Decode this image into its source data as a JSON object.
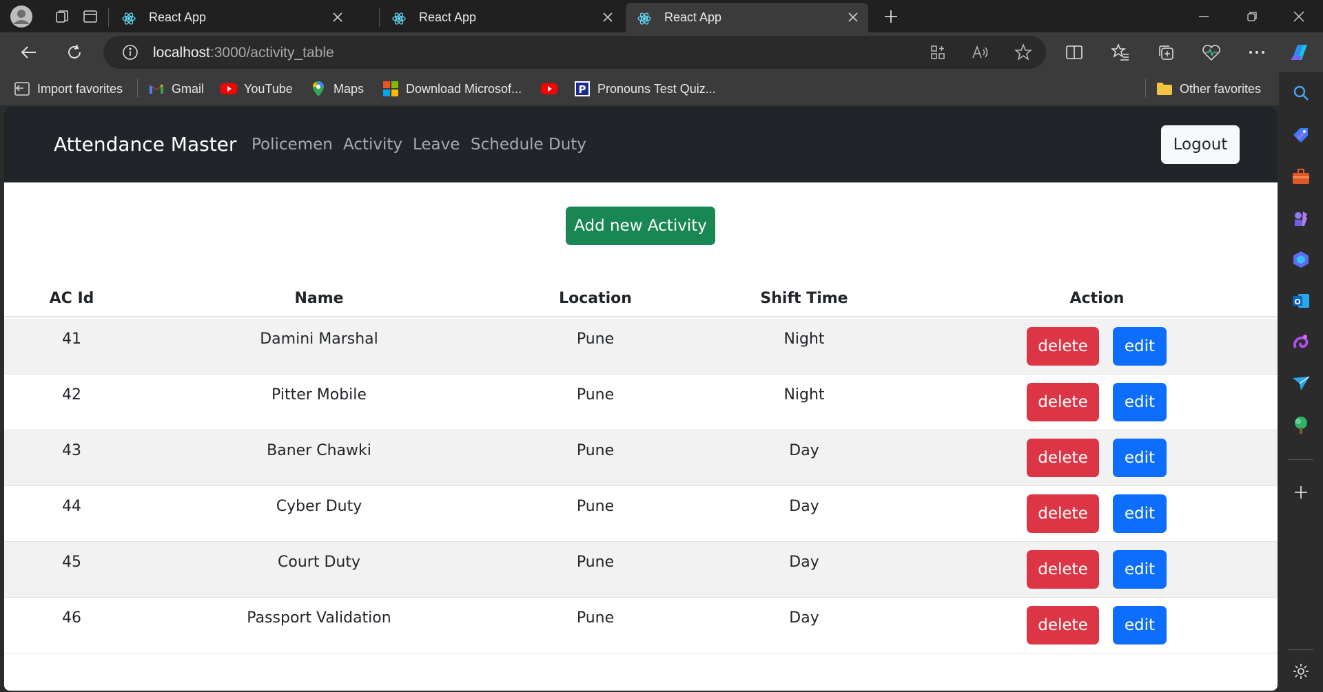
{
  "browser": {
    "tabs": [
      {
        "title": "React App",
        "active": false
      },
      {
        "title": "React App",
        "active": false
      },
      {
        "title": "React App",
        "active": true
      }
    ],
    "url": {
      "host": "localhost",
      "path": ":3000/activity_table"
    },
    "bookmarks": [
      {
        "label": "Import favorites",
        "icon": "import-icon"
      },
      {
        "label": "Gmail",
        "icon": "gmail-icon"
      },
      {
        "label": "YouTube",
        "icon": "youtube-icon"
      },
      {
        "label": "Maps",
        "icon": "maps-pin-icon"
      },
      {
        "label": "Download Microsof...",
        "icon": "microsoft-logo-icon"
      },
      {
        "label": "",
        "icon": "youtube-icon"
      },
      {
        "label": "Pronouns Test Quiz...",
        "icon": "p-logo-icon"
      }
    ],
    "other_favorites": "Other favorites",
    "colors": {
      "frame": "#202020",
      "toolbar": "#3b3b3b",
      "accent_blue": "#0d6efd",
      "accent_red": "#dc3545",
      "accent_green": "#198754"
    }
  },
  "app": {
    "brand": "Attendance Master",
    "nav": [
      "Policemen",
      "Activity",
      "Leave",
      "Schedule Duty"
    ],
    "logout_label": "Logout",
    "add_button_label": "Add new Activity",
    "table": {
      "columns": [
        "AC Id",
        "Name",
        "Location",
        "Shift Time",
        "Action"
      ],
      "rows": [
        {
          "id": "41",
          "name": "Damini Marshal",
          "location": "Pune",
          "shift": "Night"
        },
        {
          "id": "42",
          "name": "Pitter Mobile",
          "location": "Pune",
          "shift": "Night"
        },
        {
          "id": "43",
          "name": "Baner Chawki",
          "location": "Pune",
          "shift": "Day"
        },
        {
          "id": "44",
          "name": "Cyber Duty",
          "location": "Pune",
          "shift": "Day"
        },
        {
          "id": "45",
          "name": "Court Duty",
          "location": "Pune",
          "shift": "Day"
        },
        {
          "id": "46",
          "name": "Passport Validation",
          "location": "Pune",
          "shift": "Day"
        }
      ],
      "delete_label": "delete",
      "edit_label": "edit"
    }
  }
}
